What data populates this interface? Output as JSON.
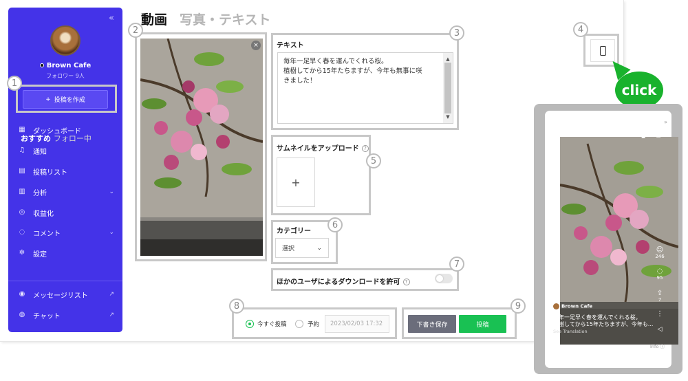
{
  "sidebar": {
    "collapse_icon": "«",
    "account_name": "Brown Cafe",
    "followers": "フォロワー 9人",
    "create_button": "投稿を作成",
    "items": [
      {
        "label": "ダッシュボード",
        "icon": "grid-icon"
      },
      {
        "label": "通知",
        "icon": "bell-icon"
      },
      {
        "label": "投稿リスト",
        "icon": "list-icon"
      },
      {
        "label": "分析",
        "icon": "chart-icon"
      },
      {
        "label": "収益化",
        "icon": "coin-icon"
      },
      {
        "label": "コメント",
        "icon": "comment-icon"
      },
      {
        "label": "設定",
        "icon": "gear-icon"
      }
    ],
    "bottom_items": [
      {
        "label": "メッセージリスト",
        "icon": "message-icon"
      },
      {
        "label": "チャット",
        "icon": "chat-icon"
      }
    ]
  },
  "tabs": [
    "動画",
    "写真・テキスト"
  ],
  "badges": [
    "1",
    "2",
    "3",
    "4",
    "5",
    "6",
    "7",
    "8",
    "9"
  ],
  "text_section": {
    "label": "テキスト",
    "lines": [
      "毎年一足早く春を運んでくれる桜。",
      "植樹してから15年たちますが、今年も無事に咲",
      "きました！"
    ]
  },
  "thumbnail": {
    "label": "サムネイルをアップロード",
    "plus": "+"
  },
  "category": {
    "label": "カテゴリー",
    "selected": "選択"
  },
  "download": {
    "label": "ほかのユーザによるダウンロードを許可"
  },
  "schedule": {
    "now": "今すぐ投稿",
    "scheduled": "予約",
    "date": "2023/02/03 17:32"
  },
  "actions": {
    "draft": "下書き保存",
    "post": "投稿"
  },
  "click_label": "click",
  "preview": {
    "tab_active": "おすすめ",
    "tab_inactive": "フォロー中",
    "like_count": "246",
    "comment_count": "95",
    "share_count": "7",
    "account": "Brown Cafe",
    "caption_line1": "毎年一足早く春を運んでくれる桜。",
    "caption_line2": "植樹してから15年たちますが、今年も...",
    "see_translation": "See Translation",
    "info": "Info"
  },
  "colors": {
    "sidebar": "#4433e8",
    "accent_green": "#19c153",
    "draft_button": "#6b6d7b"
  }
}
